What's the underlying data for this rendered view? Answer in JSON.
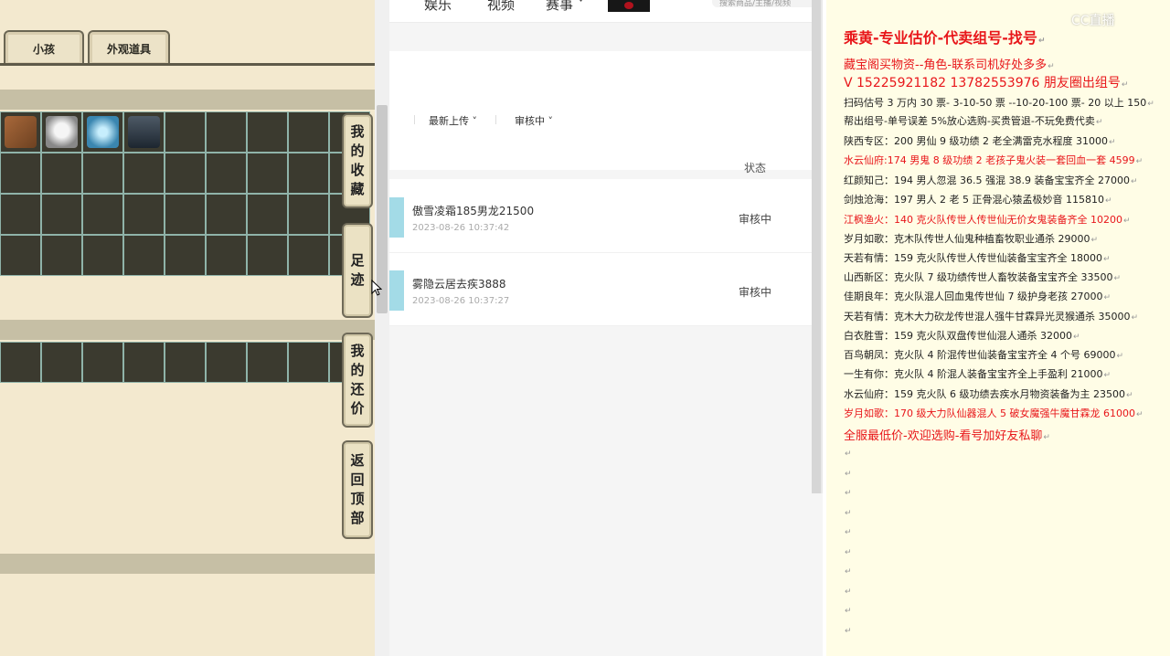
{
  "game": {
    "tabs": [
      "小孩",
      "外观道具"
    ],
    "side_buttons": [
      {
        "chars": [
          "我",
          "的",
          "收",
          "藏"
        ]
      },
      {
        "chars": [
          "足",
          "迹"
        ]
      },
      {
        "chars": [
          "我",
          "的",
          "还",
          "价"
        ]
      },
      {
        "chars": [
          "返",
          "回",
          "顶",
          "部"
        ]
      }
    ]
  },
  "web": {
    "nav": [
      "娱乐",
      "视频",
      "赛事 ˅"
    ],
    "search_placeholder": "搜索商品/主播/视频",
    "filters": [
      "最新上传",
      "审核中"
    ],
    "status_header": "状态",
    "rows": [
      {
        "title": "傲雪凌霜185男龙21500",
        "time": "2023-08-26 10:37:42",
        "status": "审核中"
      },
      {
        "title": "雾隐云居去疾3888",
        "time": "2023-08-26 10:37:27",
        "status": "审核中"
      }
    ]
  },
  "notes": {
    "lines": [
      {
        "text": "乘黄-专业估价-代卖组号-找号",
        "color": "#e8161a",
        "size": 16,
        "bold": true
      },
      {
        "text": "藏宝阁买物资--角色-联系司机好处多多",
        "color": "#e8161a",
        "size": 13
      },
      {
        "text": "V 15225921182   13782553976 朋友圈出组号",
        "color": "#e8161a",
        "size": 14
      },
      {
        "text": "扫码估号 3 万内 30 票- 3-10-50 票  --10-20-100 票- 20 以上 150",
        "color": "#1f1f1f",
        "size": 11
      },
      {
        "text": "帮出组号-单号误差 5%放心选购-买贵管退-不玩免费代卖",
        "color": "#1f1f1f",
        "size": 11
      },
      {
        "text": "陕西专区：200 男仙 9 级功绩 2 老全满雷克水程度 31000",
        "color": "#1f1f1f",
        "size": 11
      },
      {
        "text": "水云仙府:174 男鬼 8 级功绩 2 老孩子鬼火装一套回血一套 4599",
        "color": "#e8161a",
        "size": 11
      },
      {
        "text": "红颜知己：194 男人忽混 36.5 强混 38.9 装备宝宝齐全 27000",
        "color": "#1f1f1f",
        "size": 11
      },
      {
        "text": "剑烛沧海：197 男人 2 老 5 正骨混心猿孟极妙音 115810",
        "color": "#1f1f1f",
        "size": 11
      },
      {
        "text": "江枫渔火：140 克火队传世人传世仙无价女鬼装备齐全 10200",
        "color": "#e8161a",
        "size": 11
      },
      {
        "text": "岁月如歌：克木队传世人仙鬼种植畜牧职业通杀 29000",
        "color": "#1f1f1f",
        "size": 11
      },
      {
        "text": "天若有情：159 克火队传世人传世仙装备宝宝齐全 18000",
        "color": "#1f1f1f",
        "size": 11
      },
      {
        "text": "山西新区：克火队 7 级功绩传世人畜牧装备宝宝齐全 33500",
        "color": "#1f1f1f",
        "size": 11
      },
      {
        "text": "佳期良年：克火队混人回血鬼传世仙 7 级护身老孩 27000",
        "color": "#1f1f1f",
        "size": 11
      },
      {
        "text": "天若有情：克木大力砍龙传世混人强牛甘霖异光灵猴通杀 35000",
        "color": "#1f1f1f",
        "size": 11
      },
      {
        "text": "白衣胜雪：159 克火队双盘传世仙混人通杀 32000",
        "color": "#1f1f1f",
        "size": 11
      },
      {
        "text": "百鸟朝凤：克火队 4 阶混传世仙装备宝宝齐全 4 个号 69000",
        "color": "#1f1f1f",
        "size": 11
      },
      {
        "text": "一生有你：克火队 4 阶混人装备宝宝齐全上手盈利 21000",
        "color": "#1f1f1f",
        "size": 11
      },
      {
        "text": "水云仙府：159 克火队 6 级功绩去疾水月物资装备为主 23500",
        "color": "#1f1f1f",
        "size": 11
      },
      {
        "text": "岁月如歌：170 级大力队仙器混人 5 破女魔强牛魔甘霖龙 61000",
        "color": "#e8161a",
        "size": 11
      },
      {
        "text": "全服最低价-欢迎选购-看号加好友私聊",
        "color": "#e8161a",
        "size": 13
      }
    ],
    "empty_lines": 10,
    "return_mark": "↵"
  },
  "watermark": "CC直播"
}
